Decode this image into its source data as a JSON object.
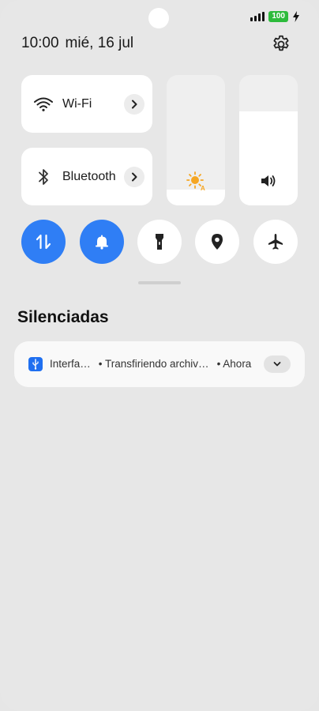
{
  "status_bar": {
    "battery": "100"
  },
  "header": {
    "time": "10:00",
    "date": "mié, 16 jul"
  },
  "tiles": {
    "wifi": {
      "label": "Wi-Fi"
    },
    "bluetooth": {
      "label": "Bluetooth"
    }
  },
  "sliders": {
    "brightness": {
      "level_percent": 12
    },
    "volume": {
      "level_percent": 72
    }
  },
  "quick_toggles": [
    {
      "name": "mobile-data",
      "state": "on"
    },
    {
      "name": "sound",
      "state": "on"
    },
    {
      "name": "flashlight",
      "state": "off"
    },
    {
      "name": "location",
      "state": "off"
    },
    {
      "name": "airplane-mode",
      "state": "off"
    }
  ],
  "section": {
    "title": "Silenciadas"
  },
  "notification": {
    "app": "Interfa…",
    "text": "• Transfiriendo archiv…",
    "time": "• Ahora"
  },
  "colors": {
    "accent": "#2f7ef5",
    "battery": "#2dbb3c",
    "sun": "#f5a623"
  }
}
